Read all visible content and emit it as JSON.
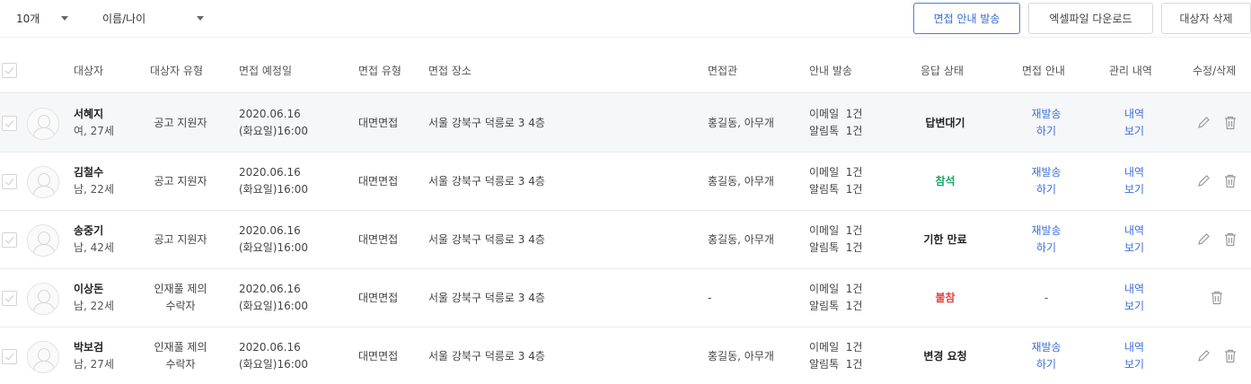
{
  "toolbar": {
    "page_size": "10개",
    "sort": "이름/나이",
    "send_invite_label": "면접 안내 발송",
    "excel_label": "엑셀파일 다운로드",
    "delete_label": "대상자 삭제"
  },
  "columns": {
    "target": "대상자",
    "type": "대상자 유형",
    "date": "면접 예정일",
    "interview_type": "면접 유형",
    "place": "면접 장소",
    "interviewer": "면접관",
    "notice": "안내 발송",
    "response": "응답 상태",
    "interview_notice": "면접 안내",
    "history": "관리 내역",
    "edit_delete": "수정/삭제"
  },
  "rows": [
    {
      "name": "서혜지",
      "info": "여, 27세",
      "type_l1": "공고 지원자",
      "type_l2": "",
      "date_l1": "2020.06.16",
      "date_l2": "(화요일)16:00",
      "interview_type": "대면면접",
      "place": "서울 강북구 덕릉로 3 4층",
      "interviewer": "홍길동, 아무개",
      "notice_l1": "이메일  1건",
      "notice_l2": "알림톡  1건",
      "response": "답변대기",
      "response_class": "status-wait",
      "resend_l1": "재발송",
      "resend_l2": "하기",
      "history_l1": "내역",
      "history_l2": "보기",
      "has_edit": true
    },
    {
      "name": "김철수",
      "info": "남, 22세",
      "type_l1": "공고 지원자",
      "type_l2": "",
      "date_l1": "2020.06.16",
      "date_l2": "(화요일)16:00",
      "interview_type": "대면면접",
      "place": "서울 강북구 덕릉로 3 4층",
      "interviewer": "홍길동, 아무개",
      "notice_l1": "이메일  1건",
      "notice_l2": "알림톡  1건",
      "response": "참석",
      "response_class": "status-ok",
      "resend_l1": "재발송",
      "resend_l2": "하기",
      "history_l1": "내역",
      "history_l2": "보기",
      "has_edit": true
    },
    {
      "name": "송중기",
      "info": "남, 42세",
      "type_l1": "공고 지원자",
      "type_l2": "",
      "date_l1": "2020.06.16",
      "date_l2": "(화요일)16:00",
      "interview_type": "대면면접",
      "place": "서울 강북구 덕릉로 3 4층",
      "interviewer": "홍길동, 아무개",
      "notice_l1": "이메일  1건",
      "notice_l2": "알림톡  1건",
      "response": "기한 만료",
      "response_class": "status-exp",
      "resend_l1": "재발송",
      "resend_l2": "하기",
      "history_l1": "내역",
      "history_l2": "보기",
      "has_edit": true
    },
    {
      "name": "이상돈",
      "info": "남, 22세",
      "type_l1": "인재풀 제의",
      "type_l2": "수락자",
      "date_l1": "2020.06.16",
      "date_l2": "(화요일)16:00",
      "interview_type": "대면면접",
      "place": "서울 강북구 덕릉로 3 4층",
      "interviewer": "-",
      "notice_l1": "이메일  1건",
      "notice_l2": "알림톡  1건",
      "response": "불참",
      "response_class": "status-abs",
      "resend_l1": "-",
      "resend_l2": "",
      "history_l1": "내역",
      "history_l2": "보기",
      "has_edit": false
    },
    {
      "name": "박보검",
      "info": "남, 27세",
      "type_l1": "인재풀 제의",
      "type_l2": "수락자",
      "date_l1": "2020.06.16",
      "date_l2": "(화요일)16:00",
      "interview_type": "대면면접",
      "place": "서울 강북구 덕릉로 3 4층",
      "interviewer": "홍길동, 아무개",
      "notice_l1": "이메일  1건",
      "notice_l2": "알림톡  1건",
      "response": "변경 요청",
      "response_class": "status-chg",
      "resend_l1": "재발송",
      "resend_l2": "하기",
      "history_l1": "내역",
      "history_l2": "보기",
      "has_edit": true
    }
  ],
  "icons": {
    "edit": "pencil-icon",
    "delete": "trash-icon",
    "caret": "chevron-down-icon",
    "checkbox": "check-icon",
    "avatar": "user-avatar-icon"
  },
  "colors": {
    "primary": "#3368d6",
    "link": "#3b6fd9",
    "attend": "#1aa36a",
    "absent": "#e8413e",
    "row_highlight": "#f6f7f9"
  }
}
